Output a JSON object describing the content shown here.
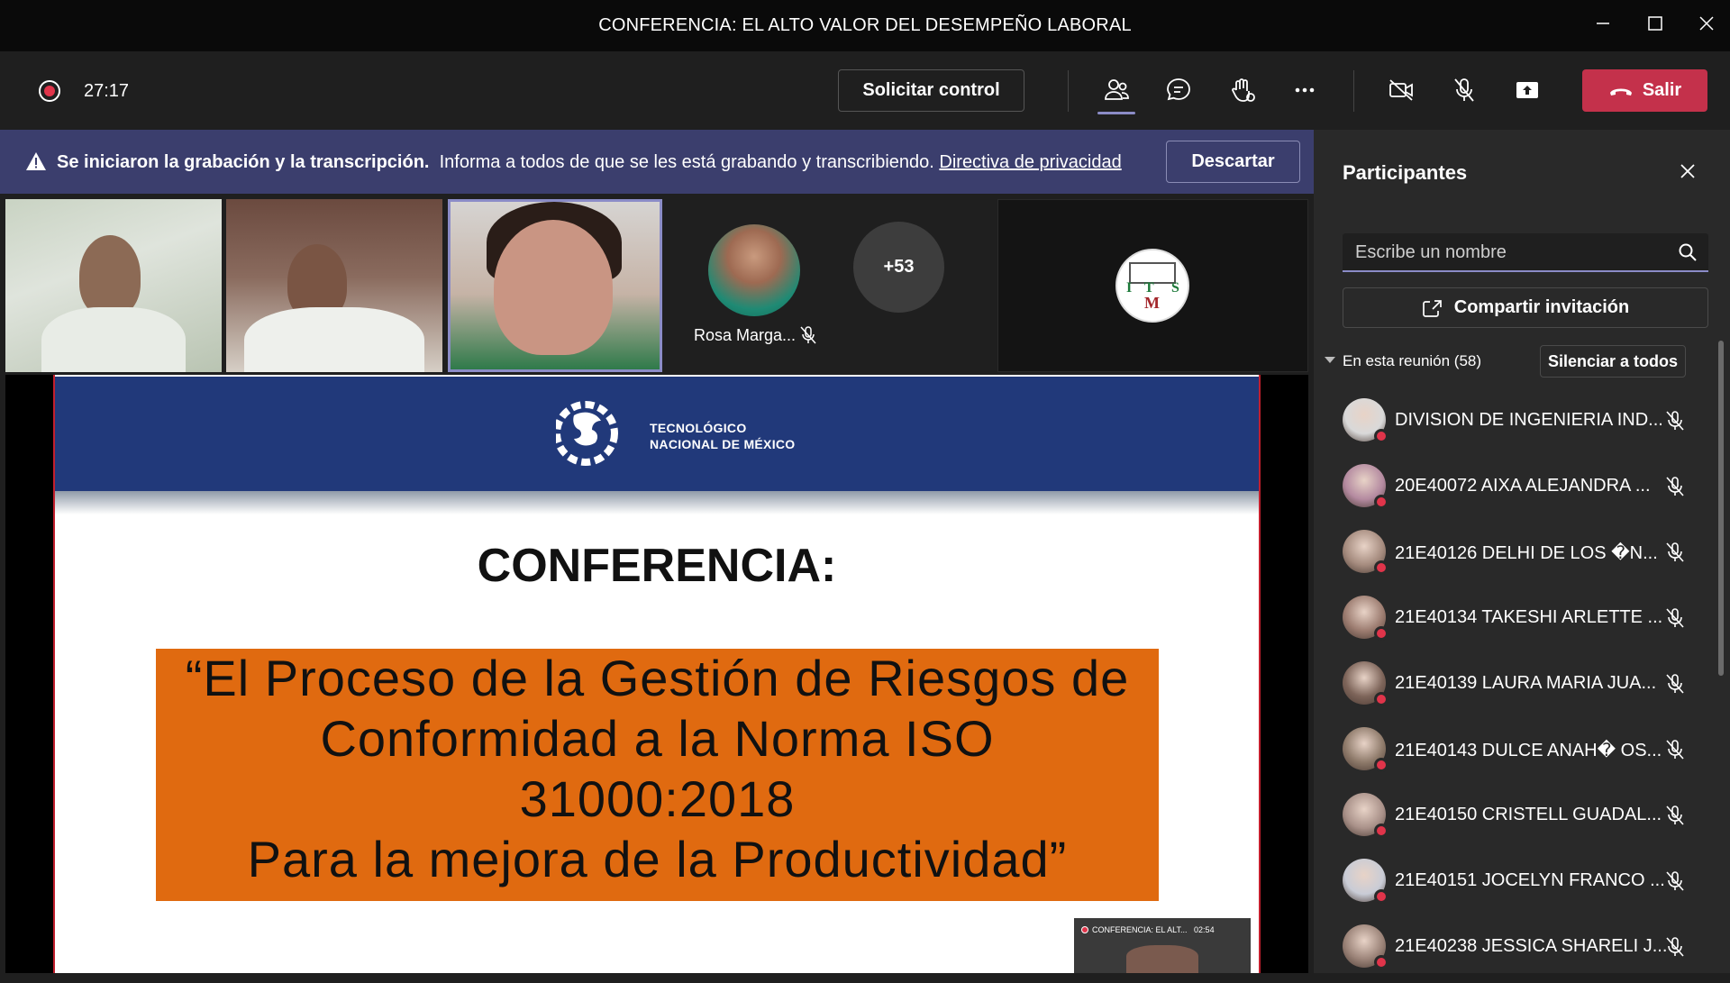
{
  "window": {
    "title": "CONFERENCIA: EL ALTO VALOR DEL DESEMPEÑO LABORAL",
    "controls": [
      "minimize",
      "maximize",
      "close"
    ]
  },
  "toolbar": {
    "timer": "27:17",
    "request_control_label": "Solicitar control",
    "leave_label": "Salir",
    "icons": [
      "people-icon",
      "chat-icon",
      "raise-hand-icon",
      "more-icon",
      "camera-off-icon",
      "mic-off-icon",
      "share-screen-icon"
    ]
  },
  "banner": {
    "bold_text": "Se iniciaron la grabación y la transcripción.",
    "text": "Informa a todos de que se les está grabando y transcribiendo.",
    "link": "Directiva de privacidad",
    "dismiss_label": "Descartar"
  },
  "strip": {
    "rosa_name": "Rosa Marga...",
    "overflow_count": "+53"
  },
  "slide": {
    "institution_line1": "TECNOLÓGICO",
    "institution_line2": "NACIONAL DE MÉXICO",
    "heading": "CONFERENCIA:",
    "title_lines": [
      "“El Proceso de la Gestión de Riesgos de",
      "Conformidad a la Norma ISO",
      "31000:2018",
      "Para la mejora de la Productividad”"
    ],
    "mini_preview_title": "CONFERENCIA: EL ALT...",
    "mini_preview_time": "02:54"
  },
  "panel": {
    "title": "Participantes",
    "search_placeholder": "Escribe un nombre",
    "share_label": "Compartir invitación",
    "group_label": "En esta reunión (58)",
    "mute_all_label": "Silenciar a todos",
    "participants": [
      {
        "name": "DIVISION DE INGENIERIA IND...",
        "color": "#d9d9d9"
      },
      {
        "name": "20E40072 AIXA ALEJANDRA ...",
        "color": "#b48aa0"
      },
      {
        "name": "21E40126 DELHI DE LOS �N...",
        "color": "#a58b7e"
      },
      {
        "name": "21E40134 TAKESHI ARLETTE ...",
        "color": "#9c7c70"
      },
      {
        "name": "21E40139 LAURA MARIA JUA...",
        "color": "#7d6459"
      },
      {
        "name": "21E40143 DULCE ANAH� OS...",
        "color": "#8e7a6a"
      },
      {
        "name": "21E40150 CRISTELL GUADAL...",
        "color": "#a99189"
      },
      {
        "name": "21E40151 JOCELYN FRANCO ...",
        "color": "#c9ccd6"
      },
      {
        "name": "21E40238 JESSICA SHARELI J...",
        "color": "#9a8277"
      }
    ]
  },
  "colors": {
    "accent": "#8b8cc7",
    "leave": "#c4314b",
    "banner": "#3b3e6d",
    "slide_header": "#21397a",
    "slide_title_box": "#e06a10",
    "recording": "#e0344a"
  }
}
